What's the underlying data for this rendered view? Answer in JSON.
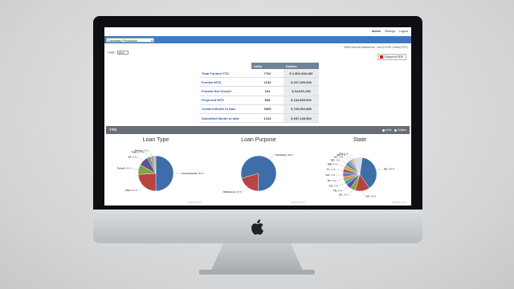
{
  "nav": {
    "admin": "Admin",
    "settings": "Settings",
    "logout": "Logout"
  },
  "company_select": {
    "value": "Company Production"
  },
  "info": {
    "text": "16966 Records Matched as : Jan 23 2015 1:56AM (PST)"
  },
  "units_control": {
    "label": "Units",
    "value": "All"
  },
  "export_pdf": {
    "label": "Export to PDF"
  },
  "summary": {
    "headers": [
      "",
      "Units",
      "Dollars"
    ],
    "rows": [
      {
        "label": "Total Funded YTD",
        "units": "7762",
        "dollars": "$ 1,502,928,180"
      },
      {
        "label": "Funded MTD",
        "units": "1154",
        "dollars": "$ 227,490,038"
      },
      {
        "label": "Funded Not Closed",
        "units": "164",
        "dollars": "$ 34,620,196"
      },
      {
        "label": "Projected MTD",
        "units": "685",
        "dollars": "$ 134,669,920"
      },
      {
        "label": "Created Month to date",
        "units": "3965",
        "dollars": "$ 725,526,868"
      },
      {
        "label": "Submitted Month to date",
        "units": "1413",
        "dollars": "$ 287,149,964"
      }
    ]
  },
  "ytd": {
    "title": "YTD",
    "option_units": "Units",
    "option_dollars": "Dollars"
  },
  "colors": {
    "accent": "#3f79c0",
    "header": "#6f8497",
    "bar": "#6a6f75"
  },
  "chart_data": [
    {
      "type": "pie",
      "title": "Loan Type",
      "credit": "Highcharts.com",
      "slices": [
        {
          "label": "Conventional",
          "value": 50,
          "display": "50 %",
          "color": "#3e6da8"
        },
        {
          "label": "FHA",
          "value": 24,
          "display": "24 %",
          "color": "#b8433f"
        },
        {
          "label": "FarmA",
          "value": 9,
          "display": "9 %",
          "color": "#7fa545"
        },
        {
          "label": "VA",
          "value": 9,
          "display": "9 %",
          "color": "#6a4e8e"
        },
        {
          "label": "Title 1",
          "value": 3,
          "display": "3 %",
          "color": "#3ca4bf"
        },
        {
          "label": "Broker",
          "value": 3,
          "display": "3 %",
          "color": "#e08d3c"
        },
        {
          "label": "",
          "value": 2,
          "display": "",
          "color": "#9db7da"
        }
      ]
    },
    {
      "type": "pie",
      "title": "Loan Purpose",
      "credit": "Highcharts.com",
      "slices": [
        {
          "label": "Purchase",
          "value": 80,
          "display": "80 %",
          "color": "#3e6da8"
        },
        {
          "label": "Refinance",
          "value": 20,
          "display": "20 %",
          "color": "#b8433f"
        }
      ]
    },
    {
      "type": "pie",
      "title": "State",
      "credit": "Highcharts.com",
      "slices": [
        {
          "label": "NC",
          "value": 38,
          "display": "38 %",
          "color": "#3e6da8"
        },
        {
          "label": "VA",
          "value": 14,
          "display": "14 %",
          "color": "#b8433f"
        },
        {
          "label": "SC",
          "value": 5,
          "display": "5 %",
          "color": "#7fa545"
        },
        {
          "label": "TN",
          "value": 5,
          "display": "5 %",
          "color": "#6a4e8e"
        },
        {
          "label": "CA",
          "value": 4,
          "display": "4 %",
          "color": "#3ca4bf"
        },
        {
          "label": "TX",
          "value": 4,
          "display": "4 %",
          "color": "#e08d3c"
        },
        {
          "label": "GA",
          "value": 4,
          "display": "4 %",
          "color": "#4f81bd"
        },
        {
          "label": "FL",
          "value": 4,
          "display": "4 %",
          "color": "#c0504d"
        },
        {
          "label": "MD",
          "value": 4,
          "display": "4 %",
          "color": "#9bbb59"
        },
        {
          "label": "DE",
          "value": 3,
          "display": "3 %",
          "color": "#8064a2"
        },
        {
          "label": "AZ",
          "value": 3,
          "display": "3 %",
          "color": "#4bacc6"
        },
        {
          "label": "PA",
          "value": 2,
          "display": "2 %",
          "color": "#f79646"
        },
        {
          "label": "TN",
          "value": 2,
          "display": "2 %",
          "color": "#a9c4e8"
        },
        {
          "label": "",
          "value": 8,
          "display": "",
          "color": "#d5dde8"
        }
      ]
    }
  ]
}
